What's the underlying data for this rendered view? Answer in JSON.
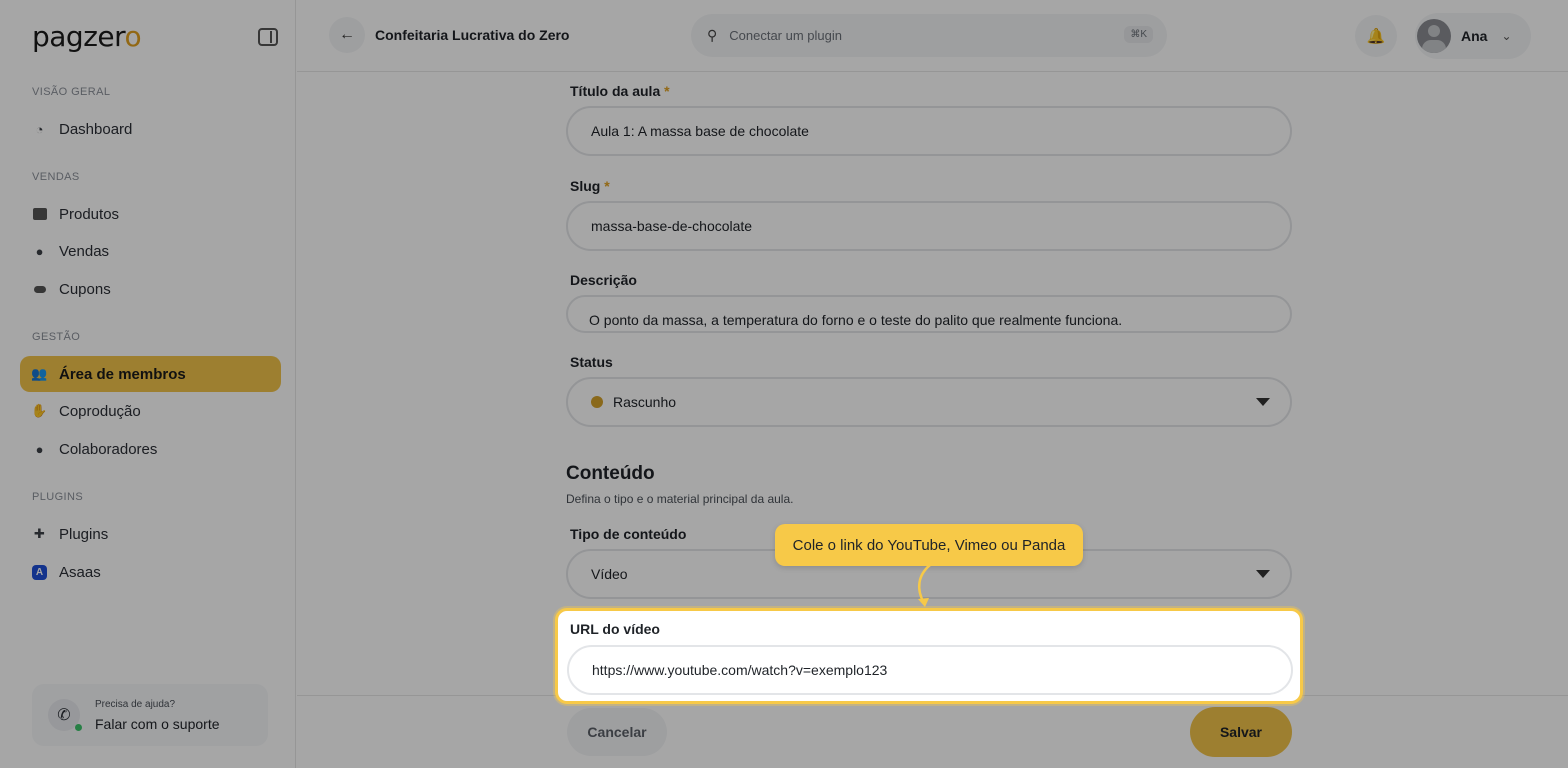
{
  "brand": {
    "logo_main": "pagzer",
    "logo_accent": "o"
  },
  "sidebar": {
    "sections": [
      {
        "title": "VISÃO GERAL"
      },
      {
        "title": "VENDAS"
      },
      {
        "title": "GESTÃO"
      },
      {
        "title": "PLUGINS"
      }
    ],
    "items": [
      {
        "label": "Dashboard"
      },
      {
        "label": "Produtos"
      },
      {
        "label": "Vendas"
      },
      {
        "label": "Cupons"
      },
      {
        "label": "Área de membros"
      },
      {
        "label": "Coprodução"
      },
      {
        "label": "Colaboradores"
      },
      {
        "label": "Plugins"
      },
      {
        "label": "Asaas"
      }
    ],
    "help": {
      "small": "Precisa de ajuda?",
      "big": "Falar com o suporte"
    }
  },
  "header": {
    "course_title": "Confeitaria Lucrativa do Zero",
    "search_placeholder": "Conectar um plugin",
    "search_shortcut": "⌘K",
    "user_name": "Ana"
  },
  "form": {
    "title_label": "Título da aula",
    "title_value": "Aula 1: A massa base de chocolate",
    "slug_label": "Slug",
    "slug_value": "massa-base-de-chocolate",
    "description_label": "Descrição",
    "description_value": "O ponto da massa, a temperatura do forno e o teste do palito que realmente funciona.",
    "status_label": "Status",
    "status_value": "Rascunho",
    "content_heading": "Conteúdo",
    "content_sub": "Defina o tipo e o material principal da aula.",
    "content_type_label": "Tipo de conteúdo",
    "content_type_value": "Vídeo",
    "video_url_label": "URL do vídeo",
    "video_url_value": "https://www.youtube.com/watch?v=exemplo123",
    "required_mark": "*"
  },
  "footer": {
    "cancel": "Cancelar",
    "save": "Salvar"
  },
  "tooltip": {
    "text": "Cole o link do YouTube, Vimeo ou Panda"
  },
  "colors": {
    "accent": "#f2c44a",
    "highlight": "#f7c948",
    "status_dot": "#d4a12a"
  }
}
